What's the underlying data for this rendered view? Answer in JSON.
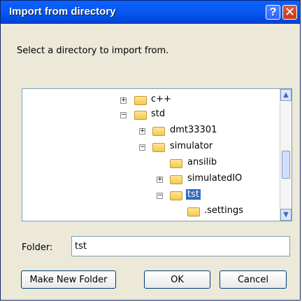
{
  "window": {
    "title": "Import from directory",
    "help_glyph": "?",
    "close_glyph": "✕"
  },
  "prompt": "Select a directory to import from.",
  "tree": {
    "items": [
      {
        "label": "c++",
        "expander": "+"
      },
      {
        "label": "std",
        "expander": "−"
      },
      {
        "label": "dmt33301",
        "expander": "+"
      },
      {
        "label": "simulator",
        "expander": "−"
      },
      {
        "label": "ansilib",
        "expander": ""
      },
      {
        "label": "simulatedIO",
        "expander": "+"
      },
      {
        "label": "tst",
        "expander": "−",
        "selected": true
      },
      {
        "label": ".settings",
        "expander": ""
      }
    ]
  },
  "folder": {
    "label": "Folder:",
    "value": "tst"
  },
  "buttons": {
    "make_new_folder": "Make New Folder",
    "ok": "OK",
    "cancel": "Cancel"
  }
}
